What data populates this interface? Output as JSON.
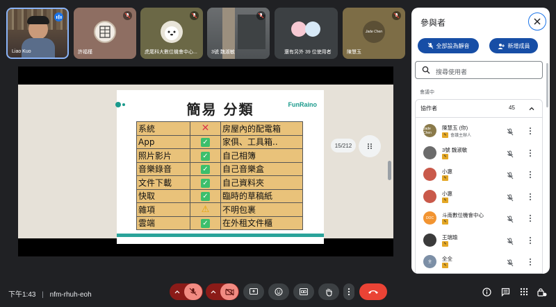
{
  "tiles": [
    {
      "name": "Liao Kuo",
      "speaking": true
    },
    {
      "name": "許福槿",
      "muted": true
    },
    {
      "name": "虎尾科大數位機會中心...",
      "muted": true
    },
    {
      "name": "3號 魏淑敏",
      "muted": true
    },
    {
      "name": "還有另外 39 位使用者"
    },
    {
      "name": "陳慧玉",
      "muted": true,
      "avatar_text": "Jade Chen"
    }
  ],
  "slide": {
    "title": "簡易 分類",
    "logo": "FunRaino",
    "rows": [
      {
        "cat": "系統",
        "status": "cross",
        "desc": "房屋內的配電箱"
      },
      {
        "cat": "App",
        "status": "check",
        "desc": "家俱、工具箱.."
      },
      {
        "cat": "照片影片",
        "status": "check",
        "desc": "自己相簿"
      },
      {
        "cat": "音樂錄音",
        "status": "check",
        "desc": "自己音樂盒"
      },
      {
        "cat": "文件下載",
        "status": "check",
        "desc": "自己資料夾"
      },
      {
        "cat": "快取",
        "status": "check",
        "desc": "臨時的草稿紙"
      },
      {
        "cat": "雜項",
        "status": "warn",
        "desc": "不明包裹"
      },
      {
        "cat": "雲端",
        "status": "check",
        "desc": "在外租文件櫃"
      }
    ],
    "page_indicator": "15/212"
  },
  "bottom": {
    "time": "下午1:43",
    "separator": "|",
    "meeting_code": "nfm-rhuh-eoh"
  },
  "panel": {
    "title": "參與者",
    "mute_all": "全部設為靜音",
    "add_people": "新增成員",
    "search_placeholder": "搜尋使用者",
    "section_label": "會議中",
    "group_title": "協作者",
    "group_count": "45",
    "participants": [
      {
        "name": "陳慧玉 (你)",
        "role": "會議主辦人",
        "avatar": "Jade Chen",
        "color": "#8a7a4a"
      },
      {
        "name": "3號 魏淑敏",
        "role": "",
        "avatar": "",
        "color": "#6b6b6b"
      },
      {
        "name": "小惠",
        "role": "",
        "avatar": "",
        "color": "#c9594a"
      },
      {
        "name": "小惠",
        "role": "",
        "avatar": "",
        "color": "#c9594a"
      },
      {
        "name": "斗南數位機會中心",
        "role": "",
        "avatar": "DOC",
        "color": "#f29431"
      },
      {
        "name": "王瑞瑜",
        "role": "",
        "avatar": "",
        "color": "#3b3b3b"
      },
      {
        "name": "全全",
        "role": "",
        "avatar": "全",
        "color": "#7c8fa6"
      }
    ]
  }
}
